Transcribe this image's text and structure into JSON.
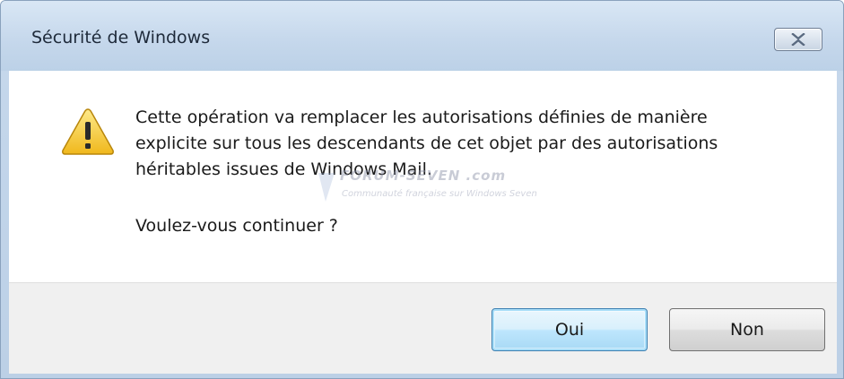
{
  "window": {
    "title": "Sécurité de Windows",
    "close_icon": "close-icon"
  },
  "dialog": {
    "icon": "warning-icon",
    "message_lines": [
      "Cette opération va remplacer les autorisations définies de manière",
      "explicite sur tous les descendants de cet objet par des autorisations",
      "héritables issues de Windows Mail."
    ],
    "question": "Voulez-vous continuer ?"
  },
  "buttons": {
    "yes_label": "Oui",
    "no_label": "Non"
  },
  "watermark": {
    "title": "FORUM-SEVEN .com",
    "subtitle": "Communauté française sur Windows Seven"
  },
  "colors": {
    "titlebar": "#c6d8ec",
    "default_button_border": "#3c7fb1",
    "footer": "#f0f0f0"
  }
}
